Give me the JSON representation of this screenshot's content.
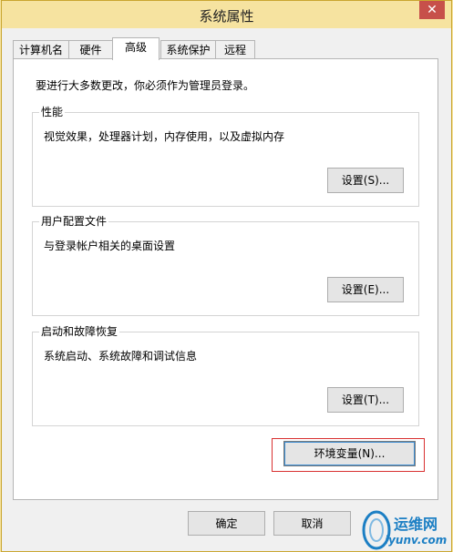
{
  "window": {
    "title": "系统属性",
    "close_label": "✕"
  },
  "tabs": [
    {
      "label": "计算机名"
    },
    {
      "label": "硬件"
    },
    {
      "label": "高级",
      "active": true
    },
    {
      "label": "系统保护"
    },
    {
      "label": "远程"
    }
  ],
  "advanced": {
    "intro": "要进行大多数更改，你必须作为管理员登录。",
    "performance": {
      "title": "性能",
      "description": "视觉效果，处理器计划，内存使用，以及虚拟内存",
      "button": "设置(S)..."
    },
    "user_profiles": {
      "title": "用户配置文件",
      "description": "与登录帐户相关的桌面设置",
      "button": "设置(E)..."
    },
    "startup_recovery": {
      "title": "启动和故障恢复",
      "description": "系统启动、系统故障和调试信息",
      "button": "设置(T)..."
    },
    "env_button": "环境变量(N)..."
  },
  "footer": {
    "ok": "确定",
    "cancel": "取消"
  },
  "watermark": {
    "text": "运维网",
    "url": "iyunv.com"
  },
  "colors": {
    "titlebar": "#f6e3a0",
    "close_button": "#c7504a",
    "highlight_box": "#d93030",
    "watermark": "#1c7fc4"
  }
}
